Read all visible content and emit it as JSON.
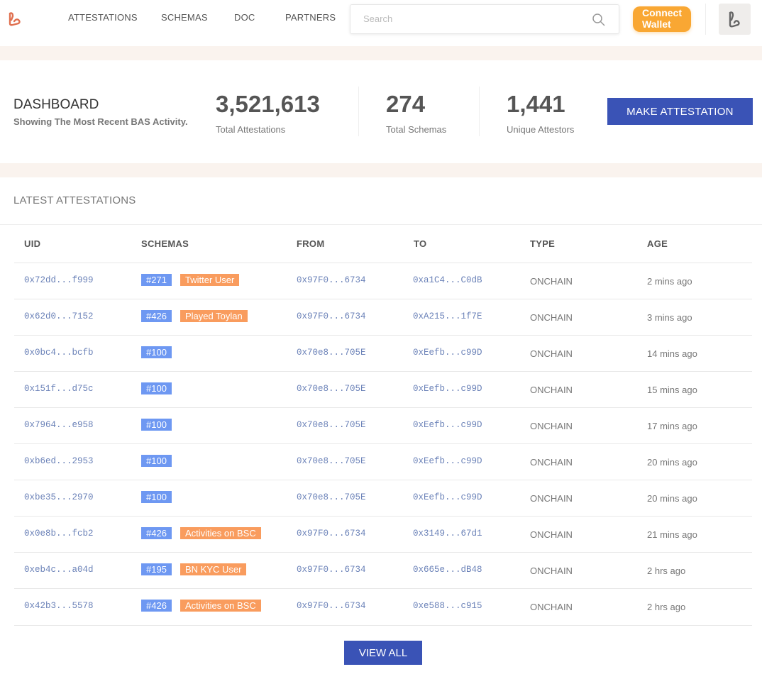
{
  "nav": {
    "items": [
      "ATTESTATIONS",
      "SCHEMAS",
      "DOC",
      "PARTNERS"
    ],
    "search_placeholder": "Search",
    "connect_wallet": "Connect Wallet"
  },
  "dashboard": {
    "title": "DASHBOARD",
    "subtitle": "Showing The Most Recent BAS Activity.",
    "stats": [
      {
        "value": "3,521,613",
        "label": "Total Attestations"
      },
      {
        "value": "274",
        "label": "Total Schemas"
      },
      {
        "value": "1,441",
        "label": "Unique Attestors"
      }
    ],
    "make_attestation": "MAKE ATTESTATION"
  },
  "latest": {
    "title": "LATEST ATTESTATIONS",
    "columns": [
      "UID",
      "SCHEMAS",
      "FROM",
      "TO",
      "TYPE",
      "AGE"
    ],
    "rows": [
      {
        "uid": "0x72dd...f999",
        "schema_id": "#271",
        "schema_name": "Twitter User",
        "from": "0x97F0...6734",
        "to": "0xa1C4...C0dB",
        "type": "ONCHAIN",
        "age": "2 mins ago"
      },
      {
        "uid": "0x62d0...7152",
        "schema_id": "#426",
        "schema_name": "Played Toylan",
        "from": "0x97F0...6734",
        "to": "0xA215...1f7E",
        "type": "ONCHAIN",
        "age": "3 mins ago"
      },
      {
        "uid": "0x0bc4...bcfb",
        "schema_id": "#100",
        "schema_name": "",
        "from": "0x70e8...705E",
        "to": "0xEefb...c99D",
        "type": "ONCHAIN",
        "age": "14 mins ago"
      },
      {
        "uid": "0x151f...d75c",
        "schema_id": "#100",
        "schema_name": "",
        "from": "0x70e8...705E",
        "to": "0xEefb...c99D",
        "type": "ONCHAIN",
        "age": "15 mins ago"
      },
      {
        "uid": "0x7964...e958",
        "schema_id": "#100",
        "schema_name": "",
        "from": "0x70e8...705E",
        "to": "0xEefb...c99D",
        "type": "ONCHAIN",
        "age": "17 mins ago"
      },
      {
        "uid": "0xb6ed...2953",
        "schema_id": "#100",
        "schema_name": "",
        "from": "0x70e8...705E",
        "to": "0xEefb...c99D",
        "type": "ONCHAIN",
        "age": "20 mins ago"
      },
      {
        "uid": "0xbe35...2970",
        "schema_id": "#100",
        "schema_name": "",
        "from": "0x70e8...705E",
        "to": "0xEefb...c99D",
        "type": "ONCHAIN",
        "age": "20 mins ago"
      },
      {
        "uid": "0x0e8b...fcb2",
        "schema_id": "#426",
        "schema_name": "Activities on BSC",
        "from": "0x97F0...6734",
        "to": "0x3149...67d1",
        "type": "ONCHAIN",
        "age": "21 mins ago"
      },
      {
        "uid": "0xeb4c...a04d",
        "schema_id": "#195",
        "schema_name": "BN KYC User",
        "from": "0x97F0...6734",
        "to": "0x665e...dB48",
        "type": "ONCHAIN",
        "age": "2 hrs ago"
      },
      {
        "uid": "0x42b3...5578",
        "schema_id": "#426",
        "schema_name": "Activities on BSC",
        "from": "0x97F0...6734",
        "to": "0xe588...c915",
        "type": "ONCHAIN",
        "age": "2 hrs ago"
      }
    ],
    "view_all": "VIEW ALL"
  },
  "colors": {
    "accent": "#3a53b6",
    "wallet": "#f9a733",
    "schema_id": "#6e98f2",
    "schema_name": "#f99c5e",
    "band": "#faf3ee"
  }
}
